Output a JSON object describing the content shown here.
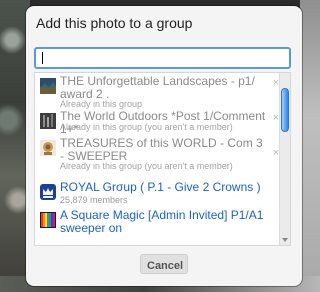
{
  "dialog": {
    "title": "Add this photo to a group",
    "search": {
      "value": "",
      "placeholder": ""
    },
    "groups": [
      {
        "name": "THE Unforgettable Landscapes - p1/ award 2 .",
        "status": "Already in this group",
        "state": "disabled",
        "icon": "landscape-thumb-icon",
        "removable": true
      },
      {
        "name": "The World Outdoors *Post 1/Comment 1+*",
        "status": "Already in this group (you aren't a member)",
        "state": "disabled",
        "icon": "outdoors-thumb-icon",
        "removable": true
      },
      {
        "name": "TREASURES of this WORLD - Com 3 - SWEEPER",
        "status": "Already in this group (you aren't a member)",
        "state": "disabled",
        "icon": "treasures-thumb-icon",
        "removable": true
      },
      {
        "name": "ROYAL Grσup ( P.1 - Give 2 Crowns )",
        "status": "25,879 members",
        "state": "enabled",
        "icon": "royal-crown-icon",
        "removable": false
      },
      {
        "name": "A Square Magic [Admin Invited] P1/A1 sweeper on",
        "status": "",
        "state": "enabled",
        "icon": "square-magic-icon",
        "removable": false
      }
    ],
    "cancel_label": "Cancel"
  },
  "colors": {
    "accent": "#5b9bd5",
    "link": "#1a5fd6",
    "disabled_text": "#8a8a8a"
  }
}
